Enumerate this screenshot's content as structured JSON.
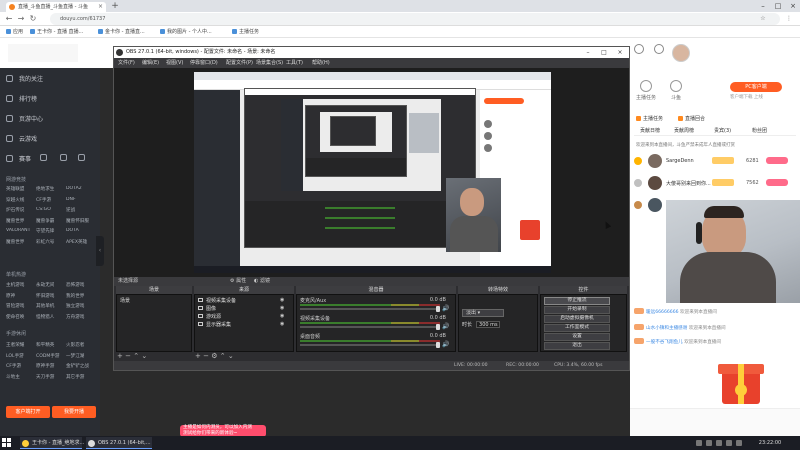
{
  "browser": {
    "tab_title": "直播_斗鱼直播_斗鱼直播 - 斗鱼",
    "url": "douyu.com/61737",
    "bookmarks": [
      "应用",
      "王卡你 - 直播 直播...",
      "金卡你 - 直播直...",
      "我的图片 - 个人中...",
      "主播任务"
    ]
  },
  "sidebar": {
    "nav": [
      "我的关注",
      "排行榜",
      "页游中心",
      "云游戏"
    ],
    "icons_row": [
      "赛事",
      "鱼吧",
      "排行",
      "分类"
    ],
    "sections": [
      {
        "title": "网游竞技",
        "items": [
          "英雄联盟",
          "绝地求生",
          "DOTA2",
          "穿越火线",
          "CF手游",
          "DNF",
          "炉石传说",
          "CS:GO",
          "逆战",
          "魔兽世界",
          "魔兽争霸",
          "魔兽怀旧服",
          "VALORANT",
          "守望先锋",
          "DOTA",
          "魔兽世界",
          "彩虹六号",
          "APEX英雄"
        ]
      },
      {
        "title": "单机热游",
        "items": [
          "主机游戏",
          "永劫无间",
          "恐怖游戏",
          "原神",
          "怀旧游戏",
          "我的世界",
          "冒险游戏",
          "其他单机",
          "独立游戏",
          "使命召唤",
          "怪物猎人",
          "方舟游戏"
        ]
      },
      {
        "title": "手游休闲",
        "items": [
          "王者荣耀",
          "和平精英",
          "火影忍者",
          "LOL手游",
          "CODM手游",
          "一梦江湖",
          "CF手游",
          "原神手游",
          "金铲铲之战",
          "斗地主",
          "天刀手游",
          "其它手游"
        ]
      }
    ],
    "btn_client": "客户端打开",
    "btn_start": "我要开播"
  },
  "obs": {
    "title": "OBS 27.0.1 (64-bit, windows) - 配置文件: 未命名 - 场景: 未命名",
    "menu": [
      "文件(F)",
      "编辑(E)",
      "视图(V)",
      "停靠窗口(D)",
      "配置文件(P)",
      "场景集合(S)",
      "工具(T)",
      "帮助(H)"
    ],
    "no_source": "未选择源",
    "props": "属性",
    "filters": "滤镜",
    "docks": {
      "scenes_title": "场景",
      "scene_item": "场景",
      "sources_title": "来源",
      "sources": [
        "视频采集设备",
        "图像",
        "游戏源",
        "显示器采集"
      ],
      "mixer_title": "混音器",
      "transitions_title": "转场特效",
      "controls_title": "控件"
    },
    "mixer": [
      {
        "label": "麦克风/Aux",
        "db": "0.0 dB"
      },
      {
        "label": "视频采集设备",
        "db": "0.0 dB"
      },
      {
        "label": "桌面音频",
        "db": "0.0 dB"
      }
    ],
    "transition": {
      "type": "淡出",
      "duration_label": "时长",
      "duration": "300 ms"
    },
    "controls": [
      "停止推流",
      "开始录制",
      "启动虚拟摄像机",
      "工作室模式",
      "设置",
      "退出"
    ],
    "status": {
      "live": "LIVE: 00:00:00",
      "rec": "REC: 00:00:00",
      "cpu": "CPU: 3.4%, 60.00 fps"
    }
  },
  "right": {
    "icons": [
      "主播任务",
      "斗鱼"
    ],
    "pc_button": "PC客户端",
    "pc_sub": "客户端下载 上线",
    "tabs": [
      "主播任务",
      "直播回合",
      "贵宾(3)",
      "粉丝团"
    ],
    "rank_tabs": [
      "贡献日榜",
      "贡献周榜"
    ],
    "notice": "欢迎来到本直播间，斗鱼严禁未成年人直播或打赏",
    "ranks": [
      {
        "name": "SargeDenn",
        "score": "6281"
      },
      {
        "name": "大傻哥别来回到你...",
        "score": "7562"
      },
      {
        "name": "",
        "score": ""
      }
    ],
    "chat": [
      {
        "nick": "暖远66666666",
        "msg": "欢迎来到本直播间"
      },
      {
        "nick": "山水小镇和主播感谢",
        "msg": "欢迎来到本直播间"
      },
      {
        "nick": "一股不谷飞翔鱼儿",
        "msg": "欢迎来到本直播间"
      }
    ]
  },
  "toast": {
    "line1": "主播是如何内测员，可以加入内测",
    "line2": "测试给你们带来的新体验~"
  },
  "taskbar": {
    "apps": [
      "王卡你 - 直播_绝地求...",
      "OBS 27.0.1 (64-bit,..."
    ],
    "time": "23:22:00"
  },
  "colors": {
    "accent": "#ff5d23",
    "obs_bg": "#2d2d30",
    "sidebar_bg": "#2a2d33"
  }
}
